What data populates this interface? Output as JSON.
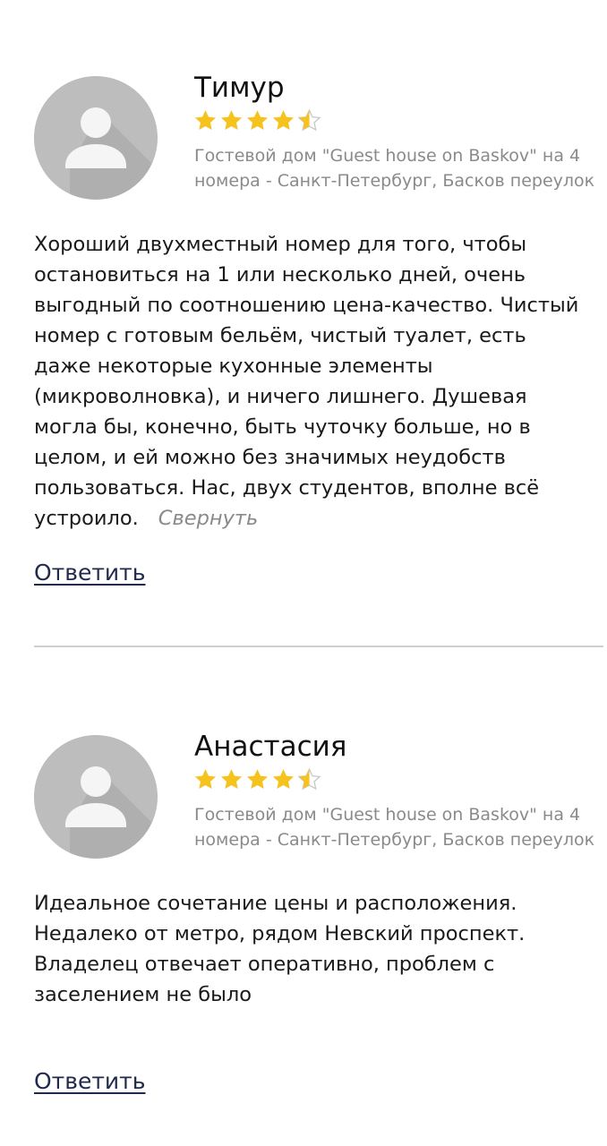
{
  "reviews": [
    {
      "author": "Тимур",
      "rating": 4.5,
      "place": "Гостевой дом \"Guest house on Baskov\" на 4 номера - Санкт-Петербург, Басков переулок",
      "text": "Хороший двухместный номер для того, чтобы остановиться на 1 или несколько дней, очень выгодный по соотношению цена-качество. Чистый номер с готовым бельём, чистый туалет, есть даже некоторые кухонные элементы (микроволновка), и ничего лишнего. Душевая могла бы, конечно, быть чуточку больше, но в целом, и ей можно без значимых неудобств пользоваться. Нас, двух студентов, вполне всё устроило.",
      "collapse_label": "Свернуть",
      "reply_label": "Ответить"
    },
    {
      "author": "Анастасия",
      "rating": 4.5,
      "place": "Гостевой дом \"Guest house on Baskov\" на 4 номера - Санкт-Петербург, Басков переулок",
      "text": "Идеальное сочетание цены и расположения. Недалеко от метро, рядом Невский проспект. Владелец отвечает оперативно, проблем с заселением не было",
      "reply_label": "Ответить"
    }
  ],
  "colors": {
    "star_fill": "#f6c21c",
    "star_empty": "#c8c8c8",
    "avatar_bg": "#bdbdbd",
    "link": "#1f2a4d",
    "muted": "#8a8a8a"
  },
  "icons": {
    "avatar": "default-user-icon",
    "star": "star-icon"
  }
}
